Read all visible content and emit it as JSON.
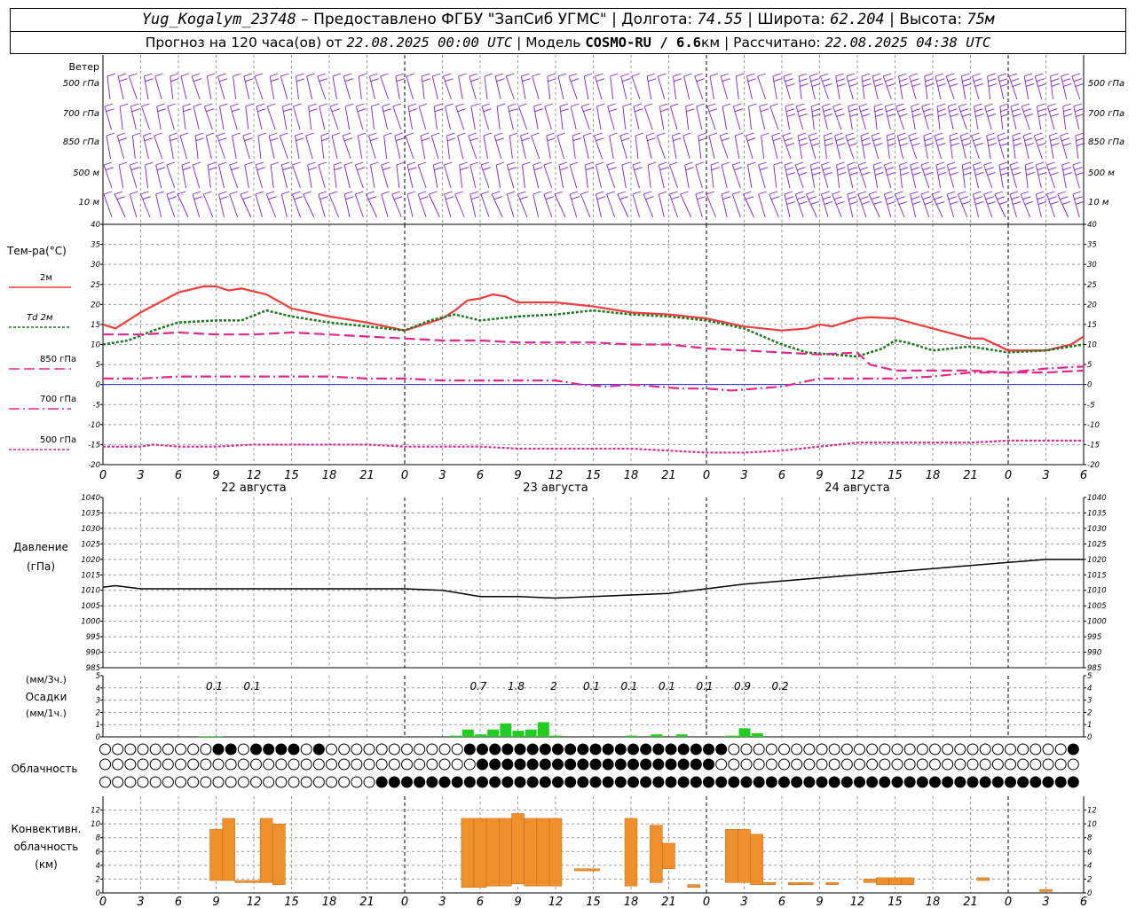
{
  "header": {
    "station": "Yug_Kogalym_23748",
    "dash": " – ",
    "provider": "Предоставлено ФГБУ \"ЗапСиб УГМС\"",
    "lon_label": "Долгота:",
    "lon": "74.55",
    "lat_label": "Широта:",
    "lat": "62.204",
    "alt_label": "Высота:",
    "alt": "75м",
    "forecast_prefix": "Прогноз на 120 часа(ов) от",
    "forecast_time": "22.08.2025 00:00 UTC",
    "model_label": "Модель",
    "model": "COSMO-RU / 6.6",
    "model_unit": "км",
    "calc_label": "Рассчитано:",
    "calc_time": "22.08.2025 04:38 UTC"
  },
  "labels": {
    "wind_title": "Ветер",
    "wind_levels": [
      "500 гПа",
      "700 гПа",
      "850 гПа",
      "500 м",
      "10  м"
    ],
    "temp_title": "Тем-ра(°C)",
    "temp_legend": [
      "2м",
      "Td  2м",
      "850 гПа",
      "700 гПа",
      "500 гПа"
    ],
    "pressure_title": [
      "Давление",
      "(гПа)"
    ],
    "precip_title": [
      "(мм/3ч.)",
      "Осадки",
      "(мм/1ч.)"
    ],
    "cloud_title": "Облачность",
    "conv_title": [
      "Конвективн.",
      "облачность",
      "(км)"
    ]
  },
  "colors": {
    "wind": "#7a1fd6",
    "t2m": "#f03c3c",
    "td2m": "#1a7a1a",
    "t850": "#e0288c",
    "t700": "#e0288c",
    "t500": "#e0288c",
    "pressure": "#000000",
    "precip": "#22cc22",
    "convective": "#f0902c"
  },
  "chart_data": [
    {
      "type": "wind_barbs",
      "levels": [
        "500 гПа",
        "700 гПа",
        "850 гПа",
        "500 м",
        "10  м"
      ],
      "x_hours": [
        0,
        120
      ],
      "note_values": "hourly barbs; directions mostly westerly to northwesterly; stronger winds aloft from ~hour 54"
    },
    {
      "type": "line",
      "xlabel": "",
      "ylabel": "Тем-ра(°C)",
      "ylim": [
        -20,
        40
      ],
      "yticks": [
        -20,
        -15,
        -10,
        -5,
        0,
        5,
        10,
        15,
        20,
        25,
        30,
        35,
        40
      ],
      "x_ticks_hours": [
        0,
        3,
        6,
        9,
        12,
        15,
        18,
        21,
        24,
        27,
        30,
        33,
        36,
        39,
        42,
        45,
        48,
        51,
        54,
        57,
        60,
        63,
        66,
        69,
        72,
        75,
        78
      ],
      "x_tick_labels": [
        "0",
        "3",
        "6",
        "9",
        "12",
        "15",
        "18",
        "21",
        "0",
        "3",
        "6",
        "9",
        "12",
        "15",
        "18",
        "21",
        "0",
        "3",
        "6",
        "9",
        "12",
        "15",
        "18",
        "21",
        "0",
        "3",
        "6"
      ],
      "day_labels": [
        {
          "hour": 12,
          "text": "22 августа"
        },
        {
          "hour": 36,
          "text": "23 августа"
        },
        {
          "hour": 60,
          "text": "24 августа"
        }
      ],
      "series": [
        {
          "name": "2м",
          "style": "solid",
          "x": [
            0,
            1,
            3,
            6,
            8,
            9,
            10,
            11,
            13,
            15,
            18,
            21,
            24,
            27,
            28,
            29,
            30,
            31,
            32,
            33,
            36,
            39,
            42,
            45,
            48,
            51,
            54,
            56,
            57,
            58,
            60,
            61,
            63,
            66,
            69,
            70,
            72,
            75,
            77,
            78
          ],
          "values": [
            15,
            14,
            18,
            23,
            24.5,
            24.5,
            23.5,
            24,
            22.5,
            19,
            17,
            15.5,
            13.5,
            16.5,
            18.5,
            21,
            21.5,
            22.5,
            22,
            20.5,
            20.5,
            19.5,
            18,
            17.5,
            16.5,
            14.5,
            13.5,
            14,
            15,
            14.5,
            16.5,
            16.8,
            16.5,
            14,
            11.5,
            11.5,
            8.5,
            8.5,
            10,
            12
          ]
        },
        {
          "name": "Td  2м",
          "style": "dotted",
          "x": [
            0,
            2,
            4,
            6,
            9,
            11,
            13,
            15,
            18,
            21,
            24,
            26,
            28,
            30,
            33,
            36,
            39,
            42,
            45,
            48,
            51,
            54,
            56,
            58,
            60,
            62,
            63,
            64,
            66,
            69,
            70,
            72,
            75,
            78
          ],
          "values": [
            10,
            11,
            13.5,
            15.5,
            16,
            16,
            18.5,
            17,
            15.5,
            14.5,
            13.5,
            16,
            17.5,
            16,
            17,
            17.5,
            18.5,
            17.5,
            17,
            16,
            14,
            10,
            8,
            7.5,
            7,
            9,
            11,
            10.5,
            8.5,
            9.5,
            9,
            8,
            8.5,
            10
          ]
        },
        {
          "name": "850 гПа",
          "style": "dashed",
          "x": [
            0,
            3,
            6,
            9,
            12,
            15,
            18,
            21,
            24,
            27,
            30,
            33,
            36,
            39,
            42,
            45,
            48,
            51,
            54,
            57,
            60,
            61,
            63,
            66,
            69,
            72,
            75,
            78
          ],
          "values": [
            12.5,
            12.5,
            13,
            12.5,
            12.5,
            13,
            12.5,
            12,
            11.5,
            11,
            11,
            10.5,
            10.5,
            10.5,
            10,
            10,
            9,
            8.5,
            8,
            7.5,
            8,
            5,
            3.5,
            3.5,
            3.5,
            3,
            3,
            3.5
          ]
        },
        {
          "name": "700 гПа",
          "style": "dashdot",
          "x": [
            0,
            3,
            6,
            9,
            12,
            15,
            18,
            21,
            24,
            27,
            30,
            33,
            36,
            38,
            40,
            42,
            44,
            46,
            48,
            50,
            52,
            54,
            57,
            60,
            63,
            66,
            69,
            72,
            75,
            78
          ],
          "values": [
            1.5,
            1.5,
            2,
            2,
            2,
            2,
            2,
            1.5,
            1.5,
            1,
            1,
            1,
            1,
            0,
            -0.5,
            0,
            -0.5,
            -1,
            -1,
            -1.5,
            -1,
            -0.5,
            1.5,
            1.5,
            1.5,
            2,
            3,
            3,
            4,
            4.5
          ]
        },
        {
          "name": "500 гПа",
          "style": "dotted",
          "x": [
            0,
            3,
            4,
            6,
            9,
            12,
            15,
            18,
            21,
            24,
            27,
            30,
            33,
            36,
            39,
            42,
            45,
            48,
            51,
            54,
            57,
            60,
            63,
            66,
            69,
            72,
            75,
            78
          ],
          "values": [
            -15.5,
            -15.5,
            -15,
            -15.5,
            -15.5,
            -15,
            -15,
            -15,
            -15,
            -15.5,
            -15.5,
            -15.5,
            -16,
            -16,
            -16,
            -16,
            -16.5,
            -17,
            -17,
            -16.5,
            -15.5,
            -14.5,
            -14.5,
            -14.5,
            -14.5,
            -14,
            -14,
            -14
          ]
        }
      ]
    },
    {
      "type": "line",
      "ylabel": "Давление (гПа)",
      "ylim": [
        985,
        1040
      ],
      "yticks": [
        985,
        990,
        995,
        1000,
        1005,
        1010,
        1015,
        1020,
        1025,
        1030,
        1035,
        1040
      ],
      "series": [
        {
          "name": "Давление",
          "x": [
            0,
            1,
            3,
            6,
            9,
            12,
            15,
            18,
            21,
            24,
            27,
            30,
            33,
            36,
            39,
            42,
            45,
            48,
            51,
            54,
            57,
            60,
            63,
            66,
            69,
            72,
            75,
            78
          ],
          "values": [
            1011,
            1011.5,
            1010.5,
            1010.5,
            1010.5,
            1010.5,
            1010.5,
            1010.5,
            1010.5,
            1010.5,
            1010,
            1008,
            1008,
            1007.5,
            1008,
            1008.5,
            1009,
            1010.5,
            1012,
            1013,
            1014,
            1015,
            1016,
            1017,
            1018,
            1019,
            1020,
            1020
          ]
        }
      ]
    },
    {
      "type": "bar",
      "ylabel": "Осадки (мм/3ч.) (мм/1ч.)",
      "ylim": [
        0,
        5
      ],
      "yticks": [
        0,
        1,
        2,
        3,
        4,
        5
      ],
      "three_hour_totals": [
        {
          "hour": 9,
          "text": "0.1"
        },
        {
          "hour": 12,
          "text": "0.1"
        },
        {
          "hour": 30,
          "text": "0.7"
        },
        {
          "hour": 33,
          "text": "1.8"
        },
        {
          "hour": 36,
          "text": "2"
        },
        {
          "hour": 39,
          "text": "0.1"
        },
        {
          "hour": 42,
          "text": "0.1"
        },
        {
          "hour": 45,
          "text": "0.1"
        },
        {
          "hour": 48,
          "text": "0.1"
        },
        {
          "hour": 51,
          "text": "0.9"
        },
        {
          "hour": 54,
          "text": "0.2"
        }
      ],
      "hourly_bars": {
        "x": [
          8,
          9,
          28,
          29,
          30,
          31,
          32,
          33,
          34,
          35,
          36,
          42,
          44,
          46,
          50,
          51,
          52
        ],
        "values": [
          0.05,
          0.05,
          0.1,
          0.6,
          0.2,
          0.6,
          1.1,
          0.5,
          0.6,
          1.2,
          0.1,
          0.1,
          0.2,
          0.2,
          0.1,
          0.7,
          0.3
        ]
      }
    },
    {
      "type": "table",
      "name": "Облачность",
      "rows_meaning": [
        "upper",
        "middle",
        "lower"
      ],
      "x_hours": [
        0,
        78
      ],
      "encoding": "circle fill fraction 0..1 per hour",
      "upper": "000000000110111101000000000001111111111111111111110000000000000000000000000001",
      "middle": "000000000000000000000000000000111111111111111111100000000000000000000000000000",
      "lower": "000000000000000000000011111111111111111111111111111111111111111111111111111111"
    },
    {
      "type": "bar",
      "ylabel": "Конвективн. облачность (км)",
      "ylim": [
        0,
        14
      ],
      "yticks": [
        0,
        2,
        4,
        6,
        8,
        10,
        12
      ],
      "segments": [
        {
          "x": 9,
          "base": 1.8,
          "top": 9.2
        },
        {
          "x": 10,
          "base": 1.8,
          "top": 10.8
        },
        {
          "x": 11,
          "base": 1.5,
          "top": 1.8
        },
        {
          "x": 12,
          "base": 1.5,
          "top": 1.8
        },
        {
          "x": 13,
          "base": 1.5,
          "top": 10.8
        },
        {
          "x": 14,
          "base": 1.2,
          "top": 10
        },
        {
          "x": 29,
          "base": 0.8,
          "top": 10.8
        },
        {
          "x": 30,
          "base": 0.8,
          "top": 10.8
        },
        {
          "x": 31,
          "base": 1.0,
          "top": 10.8
        },
        {
          "x": 32,
          "base": 1.0,
          "top": 10.8
        },
        {
          "x": 33,
          "base": 1.3,
          "top": 11.5
        },
        {
          "x": 34,
          "base": 1.0,
          "top": 10.8
        },
        {
          "x": 35,
          "base": 1.0,
          "top": 10.8
        },
        {
          "x": 36,
          "base": 1.0,
          "top": 10.8
        },
        {
          "x": 38,
          "base": 3.2,
          "top": 3.5
        },
        {
          "x": 39,
          "base": 3.2,
          "top": 3.5
        },
        {
          "x": 42,
          "base": 1.0,
          "top": 10.8
        },
        {
          "x": 44,
          "base": 1.5,
          "top": 9.8
        },
        {
          "x": 45,
          "base": 3.5,
          "top": 7.2
        },
        {
          "x": 47,
          "base": 0.8,
          "top": 1.2
        },
        {
          "x": 50,
          "base": 1.5,
          "top": 9.2
        },
        {
          "x": 51,
          "base": 1.5,
          "top": 9.2
        },
        {
          "x": 52,
          "base": 1.2,
          "top": 8.5
        },
        {
          "x": 53,
          "base": 1.2,
          "top": 1.5
        },
        {
          "x": 55,
          "base": 1.2,
          "top": 1.5
        },
        {
          "x": 56,
          "base": 1.2,
          "top": 1.5
        },
        {
          "x": 58,
          "base": 1.2,
          "top": 1.5
        },
        {
          "x": 61,
          "base": 1.5,
          "top": 2.0
        },
        {
          "x": 62,
          "base": 1.2,
          "top": 2.2
        },
        {
          "x": 63,
          "base": 1.2,
          "top": 2.2
        },
        {
          "x": 64,
          "base": 1.2,
          "top": 2.2
        },
        {
          "x": 70,
          "base": 1.8,
          "top": 2.2
        },
        {
          "x": 75,
          "base": 0.2,
          "top": 0.5
        }
      ]
    }
  ]
}
